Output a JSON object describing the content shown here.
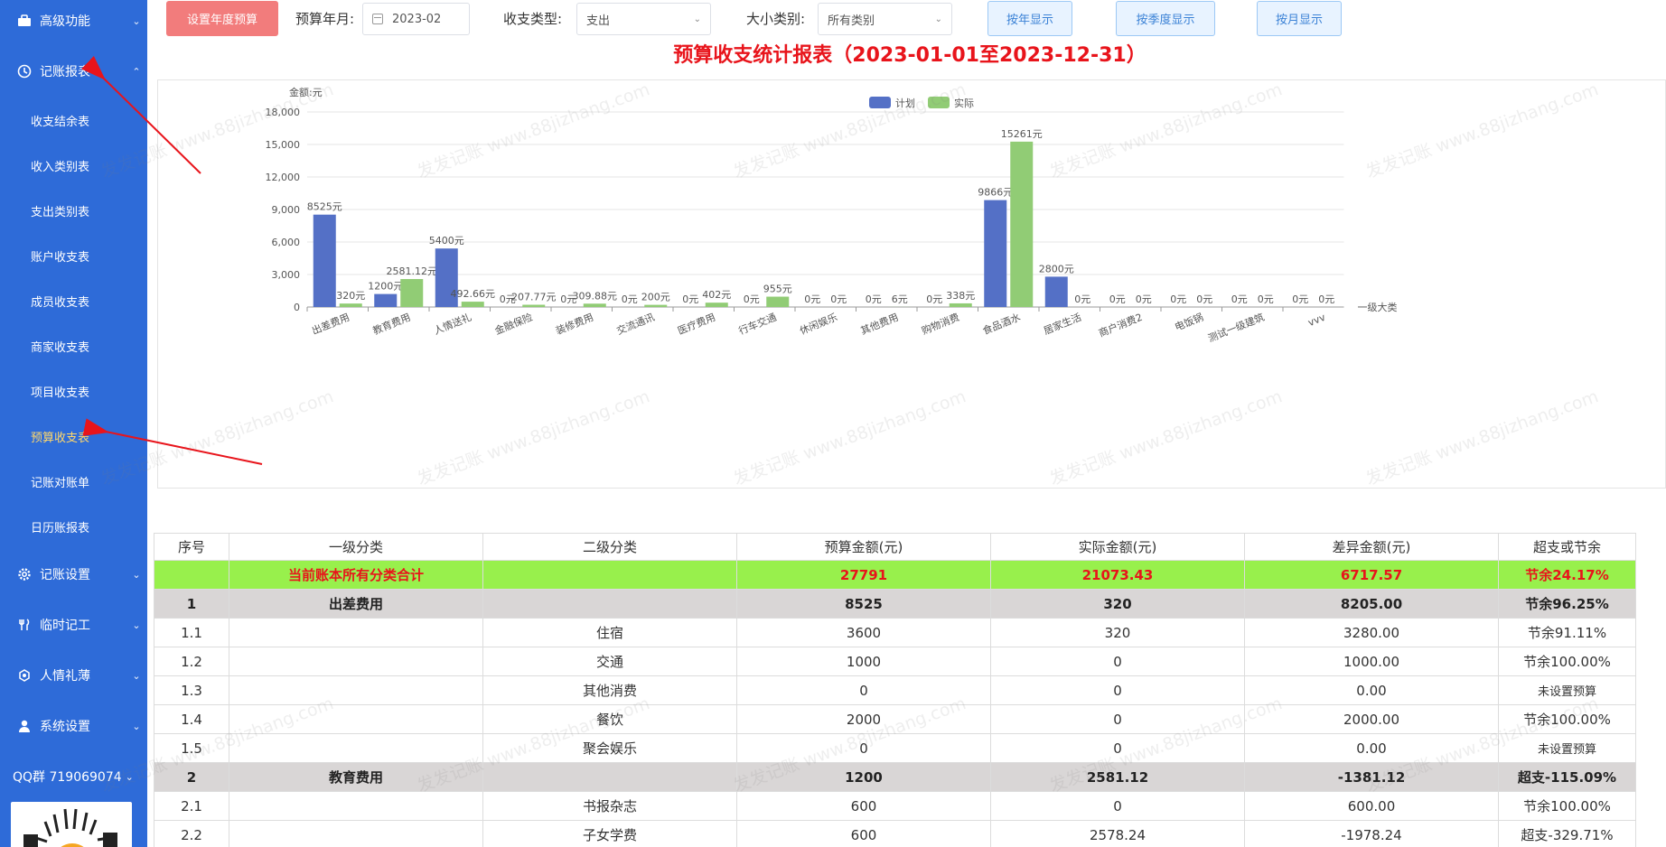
{
  "sidebar": {
    "groups": {
      "advanced": {
        "label": "高级功能",
        "icon": "briefcase-icon"
      },
      "reports": {
        "label": "记账报表",
        "icon": "clock-icon"
      },
      "settings": {
        "label": "记账设置",
        "icon": "gear-icon"
      },
      "temp_work": {
        "label": "临时记工",
        "icon": "tools-icon"
      },
      "gifts": {
        "label": "人情礼薄",
        "icon": "gift-icon"
      },
      "system": {
        "label": "系统设置",
        "icon": "user-icon"
      }
    },
    "report_items": [
      "收支结余表",
      "收入类别表",
      "支出类别表",
      "账户收支表",
      "成员收支表",
      "商家收支表",
      "项目收支表",
      "预算收支表",
      "记账对账单",
      "日历账报表"
    ],
    "active_item": "预算收支表",
    "qq_group": "QQ群 719069074"
  },
  "toolbar": {
    "set_budget_label": "设置年度预算",
    "budget_month_label": "预算年月:",
    "budget_month_value": "2023-02",
    "type_label": "收支类型:",
    "type_value": "支出",
    "category_label": "大小类别:",
    "category_value": "所有类别",
    "by_year_label": "按年显示",
    "by_quarter_label": "按季度显示",
    "by_month_label": "按月显示"
  },
  "report_title": "预算收支统计报表（2023-01-01至2023-12-31）",
  "watermark_text": "发发记账 www.88jizhang.com",
  "colors": {
    "sidebar": "#2e6bd8",
    "plan": "#5470c6",
    "actual": "#91cc75",
    "title_red": "#e8141b",
    "total_row": "#98f04c",
    "group_row": "#d9d6d6"
  },
  "chart_data": {
    "type": "bar",
    "ylabel": "金额:元",
    "xlabel": "一级大类",
    "ylim": [
      0,
      18000
    ],
    "yticks": [
      0,
      3000,
      6000,
      9000,
      12000,
      15000,
      18000
    ],
    "ytick_labels": [
      "0",
      "3,000",
      "6,000",
      "9,000",
      "12,000",
      "15,000",
      "18,000"
    ],
    "grid": true,
    "legend": "top-center",
    "value_suffix": "元",
    "categories": [
      "出差费用",
      "教育费用",
      "人情送礼",
      "金融保险",
      "装修费用",
      "交流通讯",
      "医疗费用",
      "行车交通",
      "休闲娱乐",
      "其他费用",
      "购物消费",
      "食品酒水",
      "居家生活",
      "商户消费2",
      "电饭锅",
      "测试一级建筑",
      "vvv"
    ],
    "series": [
      {
        "name": "计划",
        "values": [
          8525,
          1200,
          5400,
          0,
          0,
          0,
          0,
          0,
          0,
          0,
          0,
          9866,
          2800,
          0,
          0,
          0,
          0
        ],
        "labels": [
          "8525元",
          "1200元",
          "5400元",
          "0元",
          "0元",
          "0元",
          "0元",
          "0元",
          "0元",
          "0元",
          "0元",
          "9866元",
          "2800元",
          "0元",
          "0元",
          "0元",
          "0元"
        ]
      },
      {
        "name": "实际",
        "values": [
          320,
          2581.12,
          492.66,
          207.77,
          309.88,
          200,
          402,
          955,
          0,
          6,
          338,
          15261,
          0,
          0,
          0,
          0,
          0
        ],
        "labels": [
          "320元",
          "2581.12元",
          "492.66元",
          "207.77元",
          "309.88元",
          "200元",
          "402元",
          "955元",
          "0元",
          "6元",
          "338元",
          "15261元",
          "0元",
          "0元",
          "0元",
          "0元",
          "0元"
        ]
      }
    ]
  },
  "table": {
    "headers": [
      "序号",
      "一级分类",
      "二级分类",
      "预算金额(元)",
      "实际金额(元)",
      "差异金额(元)",
      "超支或节余"
    ],
    "rows": [
      {
        "kind": "total",
        "cells": [
          "",
          "当前账本所有分类合计",
          "",
          "27791",
          "21073.43",
          "6717.57",
          "节余24.17%"
        ]
      },
      {
        "kind": "group",
        "cells": [
          "1",
          "出差费用",
          "",
          "8525",
          "320",
          "8205.00",
          "节余96.25%"
        ]
      },
      {
        "kind": "item",
        "cells": [
          "1.1",
          "",
          "住宿",
          "3600",
          "320",
          "3280.00",
          "节余91.11%"
        ]
      },
      {
        "kind": "item",
        "cells": [
          "1.2",
          "",
          "交通",
          "1000",
          "0",
          "1000.00",
          "节余100.00%"
        ]
      },
      {
        "kind": "item",
        "cells": [
          "1.3",
          "",
          "其他消费",
          "0",
          "0",
          "0.00",
          "未设置预算"
        ]
      },
      {
        "kind": "item",
        "cells": [
          "1.4",
          "",
          "餐饮",
          "2000",
          "0",
          "2000.00",
          "节余100.00%"
        ]
      },
      {
        "kind": "item",
        "cells": [
          "1.5",
          "",
          "聚会娱乐",
          "0",
          "0",
          "0.00",
          "未设置预算"
        ]
      },
      {
        "kind": "group",
        "cells": [
          "2",
          "教育费用",
          "",
          "1200",
          "2581.12",
          "-1381.12",
          "超支-115.09%"
        ]
      },
      {
        "kind": "item",
        "cells": [
          "2.1",
          "",
          "书报杂志",
          "600",
          "0",
          "600.00",
          "节余100.00%"
        ]
      },
      {
        "kind": "item",
        "cells": [
          "2.2",
          "",
          "子女学费",
          "600",
          "2578.24",
          "-1978.24",
          "超支-329.71%"
        ]
      }
    ]
  }
}
